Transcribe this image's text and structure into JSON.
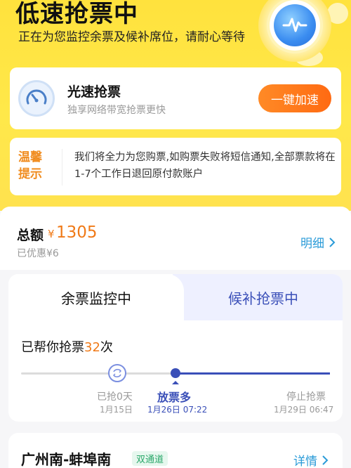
{
  "header": {
    "title": "低速抢票中",
    "subtitle": "正在为您监控余票及候补席位，请耐心等待"
  },
  "speed_card": {
    "title": "光速抢票",
    "subtitle": "独享网络带宽抢票更快",
    "button": "一键加速"
  },
  "tip": {
    "tag_line1": "温馨",
    "tag_line2": "提示",
    "text": "我们将全力为您购票,如购票失败将短信通知,全部票款将在1-7个工作日退回原付款账户"
  },
  "total": {
    "label": "总额",
    "currency": "¥",
    "amount": "1305",
    "discount": "已优惠¥6",
    "detail": "明细"
  },
  "monitor": {
    "tab_left": "余票监控中",
    "tab_right": "候补抢票中",
    "helped_prefix": "已帮你抢票",
    "helped_count": "32",
    "helped_suffix": "次",
    "steps": [
      {
        "label": "已抢0天",
        "date": "1月15日"
      },
      {
        "label": "放票多",
        "date": "1月26日 07:22"
      },
      {
        "label": "停止抢票",
        "date": "1月29日 06:47"
      }
    ]
  },
  "route": {
    "name": "广州南-蚌埠南",
    "badge": "双通道",
    "detail": "详情"
  },
  "colors": {
    "hero": "#ffe23d",
    "accent_orange": "#f07a18",
    "accent_blue": "#3a4fb8",
    "link": "#2a9bd8"
  }
}
